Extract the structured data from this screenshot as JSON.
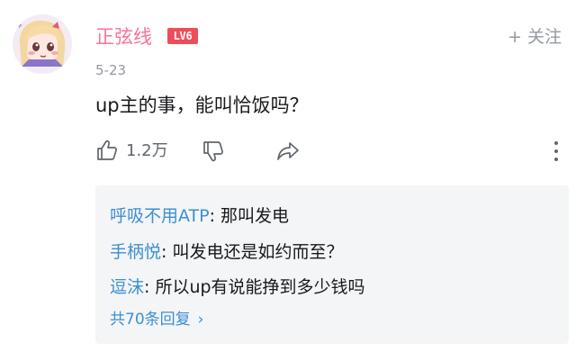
{
  "comment": {
    "username": "正弦线",
    "level": "LV6",
    "follow_label": "关注",
    "follow_icon": "+",
    "date": "5-23",
    "text": "up主的事，能叫恰饭吗？",
    "like_count": "1.2万"
  },
  "replies": [
    {
      "user": "呼吸不用ATP",
      "text": ": 那叫发电"
    },
    {
      "user": "手柄悦",
      "text": ": 叫发电还是如约而至？"
    },
    {
      "user": "逗沫",
      "text": ": 所以up有说能挣到多少钱吗"
    }
  ],
  "reply_summary": {
    "label": "共70条回复",
    "chevron": "›"
  },
  "colors": {
    "username": "#fb7299",
    "level_badge": "#ee4d5a",
    "reply_user": "#3b8fd4",
    "muted": "#9499a0",
    "reply_bg": "#f4f5f7"
  },
  "icons": [
    "avatar",
    "like-icon",
    "dislike-icon",
    "share-icon",
    "more-icon",
    "chevron-right-icon"
  ]
}
